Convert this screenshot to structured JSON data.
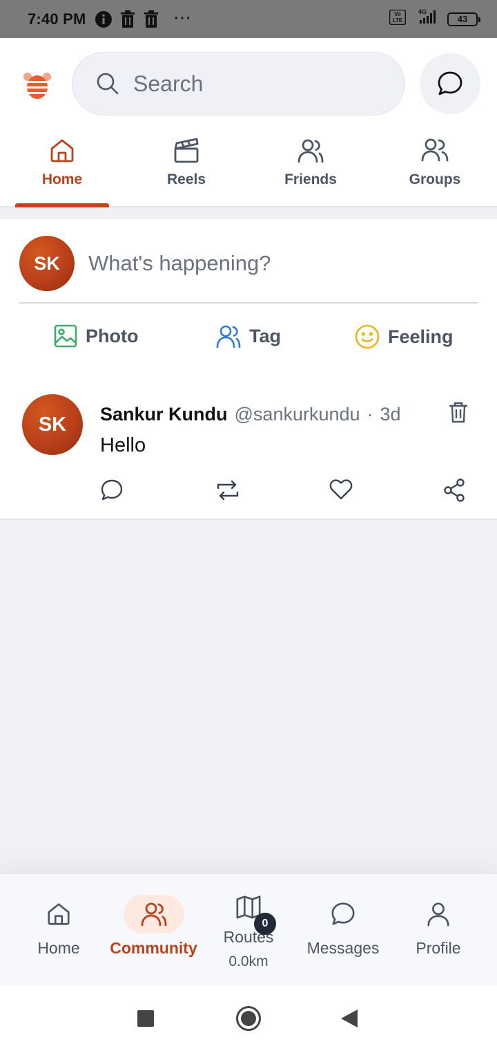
{
  "status_bar": {
    "time": "7:40 PM",
    "icons": [
      "info-icon",
      "trash-icon",
      "trash-icon",
      "more-dots-icon"
    ],
    "more": "···",
    "network_label": "4G",
    "volte_label": "Vo LTE",
    "battery": "43"
  },
  "header": {
    "logo": "app-logo-icon",
    "search_placeholder": "Search",
    "chat_icon": "chat-bubble-icon"
  },
  "tabs": [
    {
      "label": "Home",
      "icon": "home-icon",
      "active": true
    },
    {
      "label": "Reels",
      "icon": "clapperboard-icon",
      "active": false
    },
    {
      "label": "Friends",
      "icon": "friends-icon",
      "active": false
    },
    {
      "label": "Groups",
      "icon": "groups-icon",
      "active": false
    }
  ],
  "composer": {
    "avatar_initials": "SK",
    "placeholder": "What's happening?",
    "actions": [
      {
        "label": "Photo",
        "icon": "photo-icon",
        "color": "#3ea96b"
      },
      {
        "label": "Tag",
        "icon": "tag-people-icon",
        "color": "#2f7bd8"
      },
      {
        "label": "Feeling",
        "icon": "smiley-icon",
        "color": "#e9b61f"
      }
    ]
  },
  "post": {
    "avatar_initials": "SK",
    "author": "Sankur Kundu",
    "handle": "@sankurkundu",
    "separator": "·",
    "time": "3d",
    "text": "Hello",
    "actions": [
      "comment-icon",
      "repost-icon",
      "like-icon",
      "share-icon"
    ]
  },
  "bottom_nav": [
    {
      "label": "Home",
      "icon": "home-icon",
      "active": false
    },
    {
      "label": "Community",
      "icon": "community-icon",
      "active": true
    },
    {
      "label": "Routes",
      "icon": "map-icon",
      "active": false,
      "badge": "0",
      "sub": "0.0km"
    },
    {
      "label": "Messages",
      "icon": "chat-bubble-icon",
      "active": false
    },
    {
      "label": "Profile",
      "icon": "profile-icon",
      "active": false
    }
  ],
  "colors": {
    "accent": "#b8431a",
    "avatar": "#c4441a",
    "background": "#eff1f5"
  }
}
